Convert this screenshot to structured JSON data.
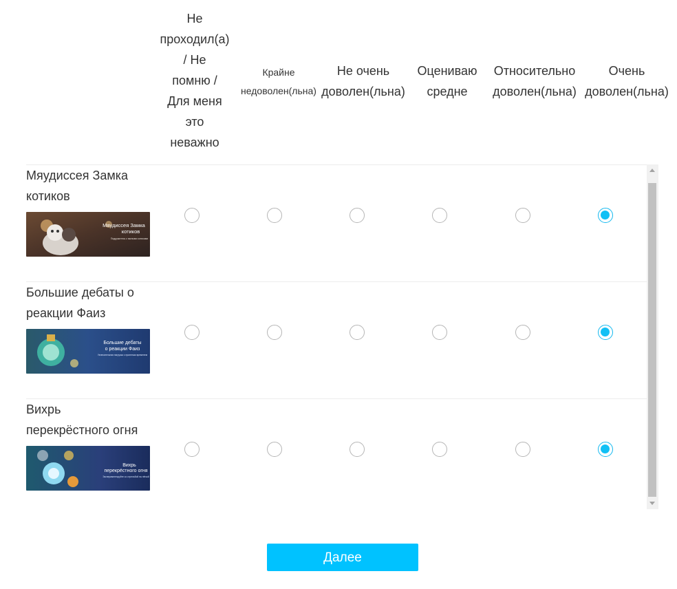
{
  "columns": [
    "Не\nпроходил(а)\n/ Не\nпомню /\nДля меня\nэто\nневажно",
    "Крайне\nнедоволен(льна)",
    "Не очень\nдоволен(льна)",
    "Оцениваю\nсредне",
    "Относительно\nдоволен(льна)",
    "Очень\nдоволен(льна)"
  ],
  "rows": [
    {
      "title": "Мяудиссея Замка\nкотиков",
      "banner": {
        "line1": "Мяудиссея Замка",
        "line2": "котиков",
        "caption": "Подружитесь с милыми котиками"
      },
      "selected_index": 5
    },
    {
      "title": "Большие дебаты о\nреакции Фаиз",
      "banner": {
        "line1": "Большие дебаты",
        "line2": "о реакции Фаиз",
        "caption": "Увлекательная нагрузка с приятным временем"
      },
      "selected_index": 5
    },
    {
      "title": "Вихрь\nперекрёстного огня",
      "banner": {
        "line1": "Вихрь",
        "line2": "перекрёстного огня",
        "caption": "Экспериментируйте со стрельбой на лёгкой"
      },
      "selected_index": 5
    }
  ],
  "next_button": "Далее",
  "colors": {
    "accent": "#00c2ff",
    "radio_border": "#b5b5b5"
  }
}
